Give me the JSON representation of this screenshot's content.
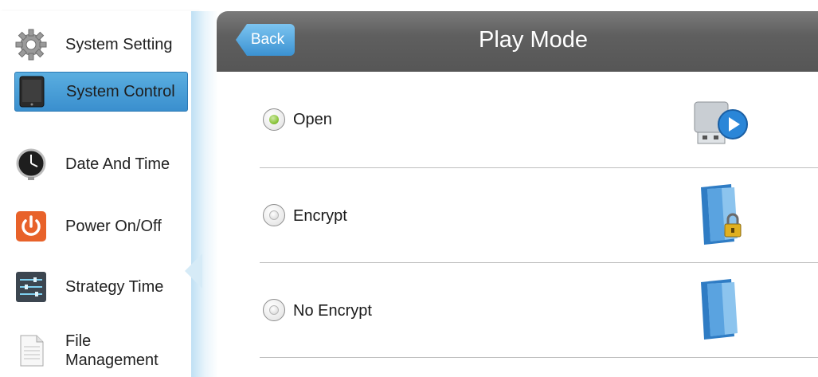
{
  "sidebar": {
    "items": [
      {
        "label": "System Setting",
        "icon": "gear-icon"
      },
      {
        "label": "System Control",
        "icon": "tablet-icon",
        "active": true
      },
      {
        "label": "Date And Time",
        "icon": "clock-icon"
      },
      {
        "label": "Power On/Off",
        "icon": "power-icon"
      },
      {
        "label": "Strategy Time",
        "icon": "sliders-icon"
      },
      {
        "label": "File\nManagement",
        "icon": "document-icon"
      }
    ]
  },
  "header": {
    "back_label": "Back",
    "title": "Play Mode"
  },
  "options": [
    {
      "label": "Open",
      "selected": true,
      "icon": "usb-play-icon"
    },
    {
      "label": "Encrypt",
      "selected": false,
      "icon": "locked-folder-icon"
    },
    {
      "label": "No Encrypt",
      "selected": false,
      "icon": "folder-icon"
    }
  ],
  "colors": {
    "accent": "#3a8fce",
    "header_bg": "#5f5f5f",
    "radio_selected": "#8cc63e",
    "power_orange": "#e8622a"
  }
}
